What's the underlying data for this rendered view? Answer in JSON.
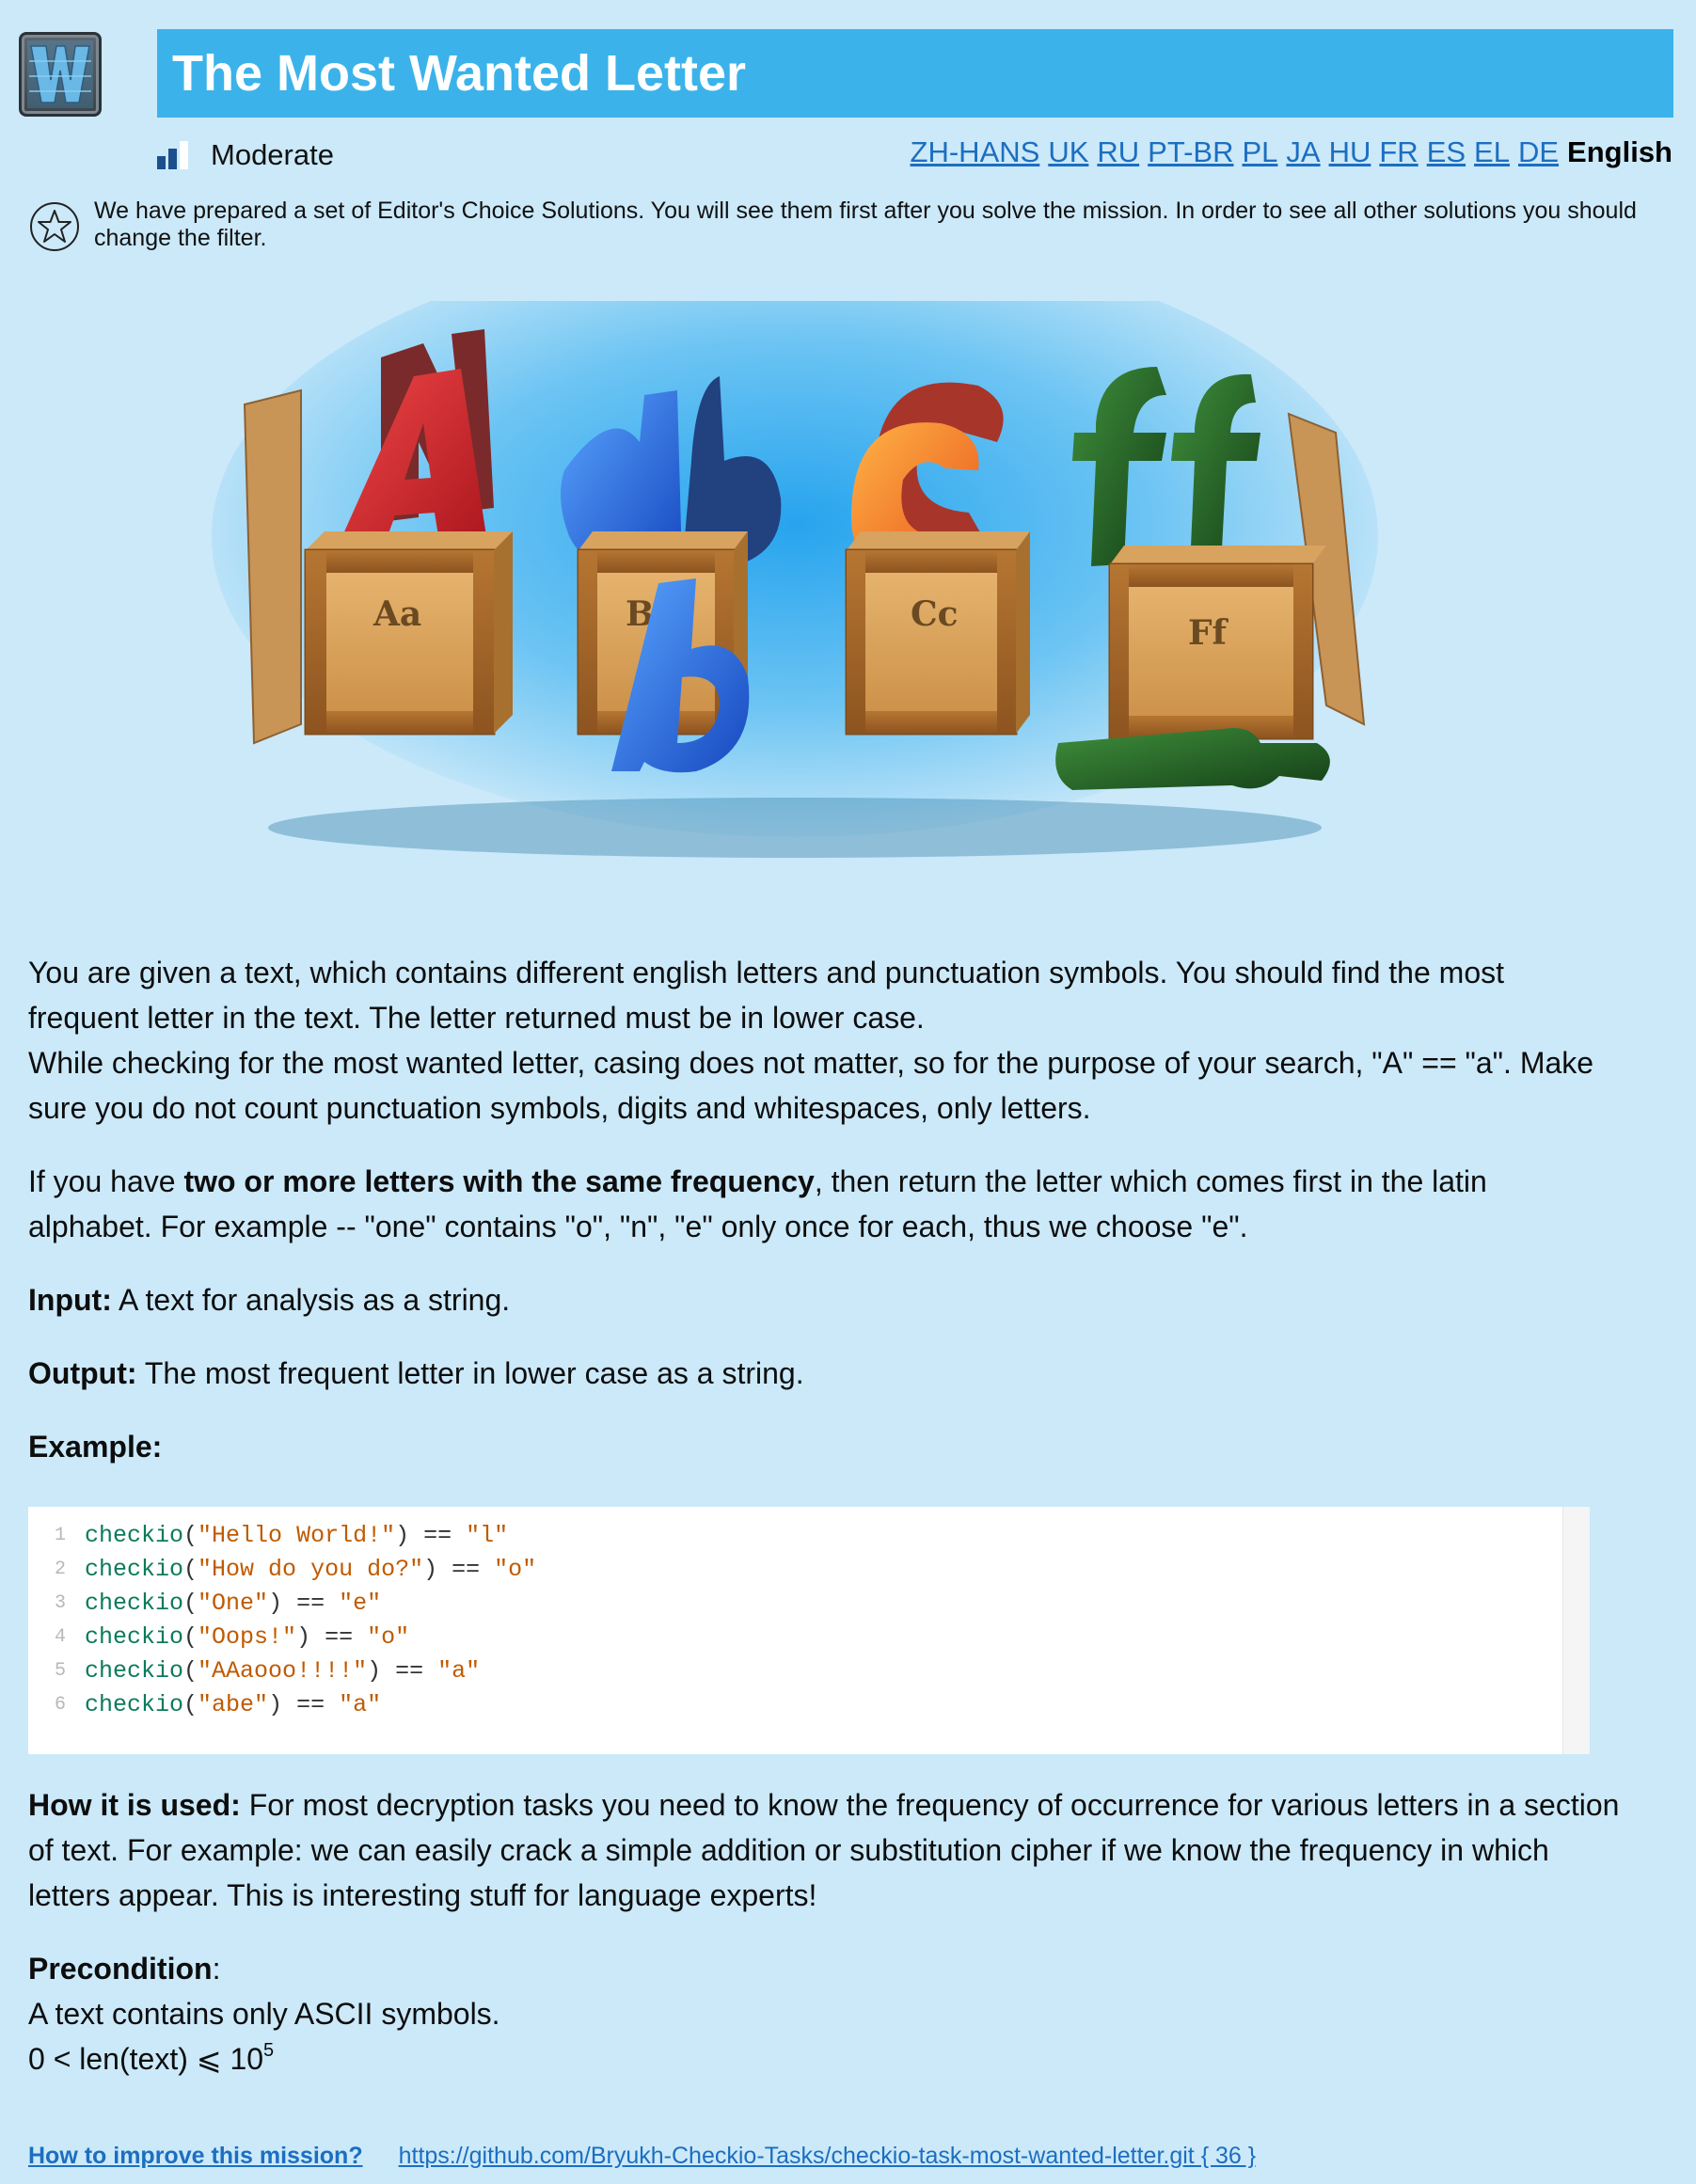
{
  "header": {
    "title": "The Most Wanted Letter",
    "logo_icon": "checkio-w-logo-icon",
    "difficulty_icon": "difficulty-bars-icon",
    "difficulty": "Moderate"
  },
  "languages": {
    "links": [
      "ZH-HANS",
      "UK",
      "RU",
      "PT-BR",
      "PL",
      "JA",
      "HU",
      "FR",
      "ES",
      "EL",
      "DE"
    ],
    "current": "English"
  },
  "notice": {
    "icon": "star-icon",
    "text": "We have prepared a set of Editor's Choice Solutions. You will see them first after you solve the mission. In order to see all other solutions you should change the filter."
  },
  "hero": {
    "crate_labels": [
      "Aa",
      "Bb",
      "Cc",
      "Ff"
    ]
  },
  "description": {
    "p1": "You are given a text, which contains different english letters and punctuation symbols. You should find the most frequent letter in the text. The letter returned must be in lower case.",
    "p2": "While checking for the most wanted letter, casing does not matter, so for the purpose of your search, \"A\" == \"a\". Make sure you do not count punctuation symbols, digits and whitespaces, only letters.",
    "p3_pre": "If you have ",
    "p3_bold": "two or more letters with the same frequency",
    "p3_post": ", then return the letter which comes first in the latin alphabet. For example -- \"one\" contains \"o\", \"n\", \"e\" only once for each, thus we choose \"e\".",
    "input_label": "Input:",
    "input_text": " A text for analysis as a string.",
    "output_label": "Output:",
    "output_text": " The most frequent letter in lower case as a string.",
    "example_label": "Example:"
  },
  "code": {
    "lines": [
      {
        "num": "1",
        "fn": "checkio",
        "arg": "\"Hello World!\"",
        "res": "\"l\""
      },
      {
        "num": "2",
        "fn": "checkio",
        "arg": "\"How do you do?\"",
        "res": "\"o\""
      },
      {
        "num": "3",
        "fn": "checkio",
        "arg": "\"One\"",
        "res": "\"e\""
      },
      {
        "num": "4",
        "fn": "checkio",
        "arg": "\"Oops!\"",
        "res": "\"o\""
      },
      {
        "num": "5",
        "fn": "checkio",
        "arg": "\"AAaooo!!!!\"",
        "res": "\"a\""
      },
      {
        "num": "6",
        "fn": "checkio",
        "arg": "\"abe\"",
        "res": "\"a\""
      }
    ]
  },
  "usage": {
    "label": "How it is used:",
    "text": " For most decryption tasks you need to know the frequency of occurrence for various letters in a section of text. For example: we can easily crack a simple addition or substitution cipher if we know the frequency in which letters appear. This is interesting stuff for language experts!"
  },
  "precondition": {
    "label": "Precondition",
    "colon": ":",
    "line1": "A text contains only ASCII symbols.",
    "line2": "0 < len(text) ⩽ 10",
    "line2_sup": "5"
  },
  "footer": {
    "improve": "How to improve this mission?",
    "repo": "https://github.com/Bryukh-Checkio-Tasks/checkio-task-most-wanted-letter.git { 36 }"
  },
  "colors": {
    "background": "#cbe9f9",
    "title_bar": "#3bb3ea",
    "link": "#1c6ec1",
    "code_fn": "#0b7a5b",
    "code_str": "#c05a00"
  }
}
